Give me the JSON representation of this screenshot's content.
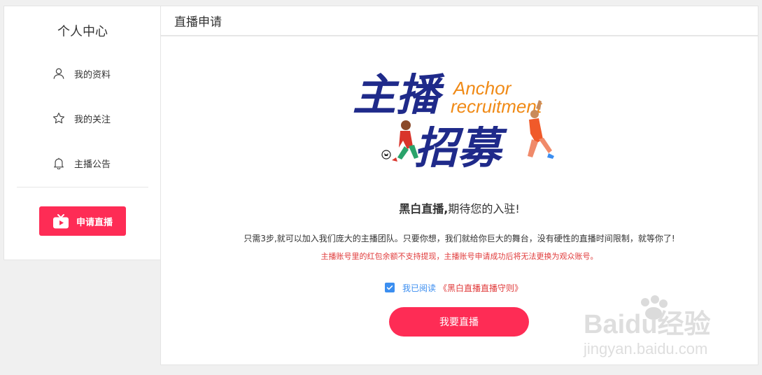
{
  "sidebar": {
    "title": "个人中心",
    "items": [
      {
        "label": "我的资料",
        "icon": "user-icon"
      },
      {
        "label": "我的关注",
        "icon": "star-icon"
      },
      {
        "label": "主播公告",
        "icon": "bell-icon"
      }
    ],
    "apply_button": {
      "label": "申请直播",
      "icon": "tv-icon"
    }
  },
  "main": {
    "header_title": "直播申请",
    "banner": {
      "cn_line1": "主播",
      "cn_line2": "招募",
      "en_line1": "Anchor",
      "en_line2": "recruitment"
    },
    "headline_bold": "黑白直播,",
    "headline_rest": "期待您的入驻!",
    "description": "只需3步,就可以加入我们庞大的主播团队。只要你想，我们就给你巨大的舞台，没有硬性的直播时间限制，就等你了!",
    "warning": "主播账号里的红包余额不支持提现，主播账号申请成功后将无法更换为观众账号。",
    "agree_label": "我已阅读",
    "rules_link": "《黑白直播直播守则》",
    "agree_checked": true,
    "go_live_button": "我要直播"
  },
  "watermark": {
    "brand": "Baidu经验",
    "url": "jingyan.baidu.com"
  },
  "colors": {
    "accent": "#fe2c55",
    "link_blue": "#3b8ef0",
    "warning_red": "#e03a3a",
    "banner_navy": "#1f2a8a",
    "banner_orange": "#f08a16"
  }
}
